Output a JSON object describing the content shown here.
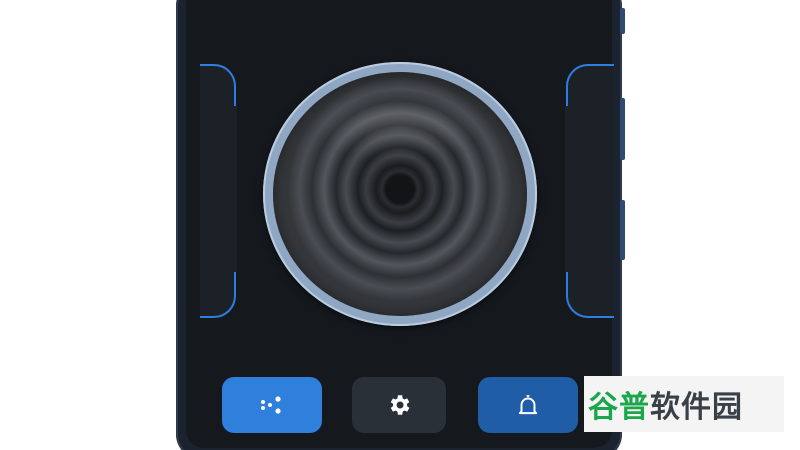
{
  "buttons": {
    "apps_icon": "apps-dots-icon",
    "settings_icon": "gear-icon",
    "notify_icon": "bell-icon"
  },
  "dial": {
    "icon": "ripple-rings"
  },
  "watermark": {
    "part1": "谷普",
    "part2": "软件园"
  },
  "colors": {
    "accent": "#2f7fdc",
    "accent_dark": "#1f5ea6",
    "screen_bg": "#15191e",
    "dial_ring": "#8fa7c3",
    "watermark_green": "#1aa64a"
  }
}
